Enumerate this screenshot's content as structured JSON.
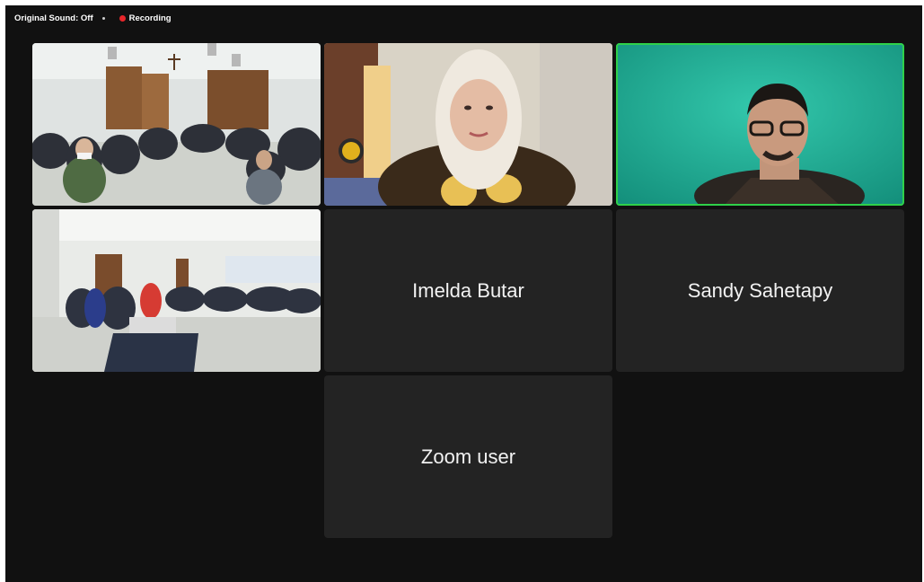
{
  "topbar": {
    "original_sound": "Original Sound: Off",
    "recording": "Recording",
    "recording_color": "#e8262a"
  },
  "tiles": [
    {
      "kind": "video",
      "scene": "classroom-seated-students",
      "name": ""
    },
    {
      "kind": "video",
      "scene": "woman-in-hijab",
      "name": ""
    },
    {
      "kind": "video",
      "scene": "man-with-glasses-green-background",
      "name": "",
      "active_speaker": true
    },
    {
      "kind": "video",
      "scene": "hall-with-audience-and-projector",
      "name": ""
    },
    {
      "kind": "name",
      "name": "Imelda Butar"
    },
    {
      "kind": "name",
      "name": "Sandy Sahetapy"
    },
    {
      "kind": "name",
      "name": "Zoom user"
    }
  ],
  "colors": {
    "background": "#111111",
    "tile": "#232323",
    "active_speaker_border": "#2fd14a"
  }
}
